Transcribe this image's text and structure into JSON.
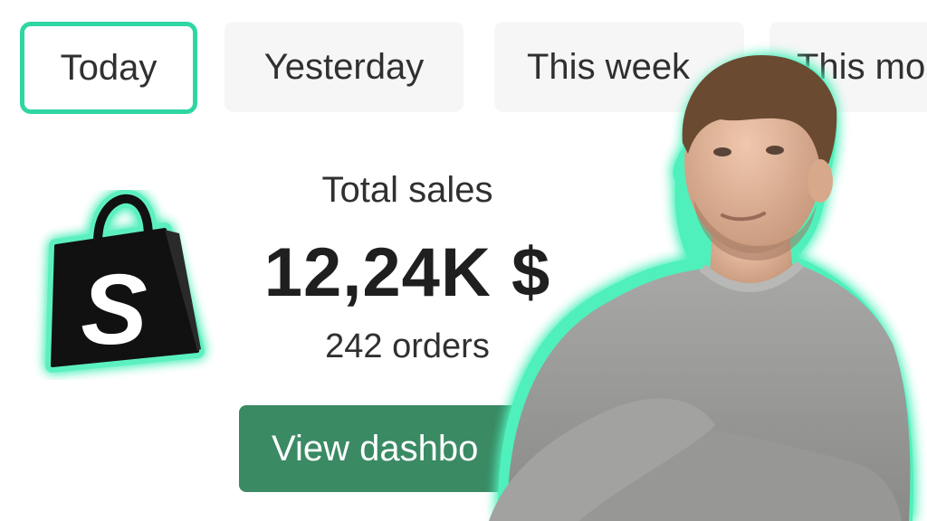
{
  "tabs": [
    {
      "label": "Today",
      "active": true
    },
    {
      "label": "Yesterday",
      "active": false
    },
    {
      "label": "This week",
      "active": false
    },
    {
      "label": "This mo",
      "active": false
    }
  ],
  "summary": {
    "label": "Total sales",
    "value": "12,24K $",
    "orders": "242 orders"
  },
  "button": {
    "label": "View dashbo"
  },
  "logo": {
    "name": "shopify-bag-icon",
    "letter": "S"
  },
  "colors": {
    "accent": "#2fd6a2",
    "button": "#3a8a64",
    "tab_bg": "#f6f6f6",
    "text": "#303030"
  }
}
